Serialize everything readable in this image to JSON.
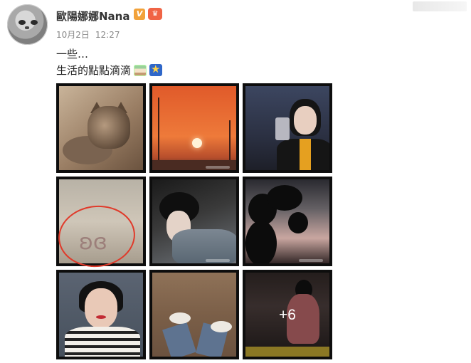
{
  "post": {
    "username": "歐陽娜娜Nana",
    "vip_badge": "V",
    "fan_badge_icon": "fan-badge-icon",
    "date": "10月2日",
    "time": "12:27",
    "line1": "一些…",
    "line2_text": "生活的點點滴滴",
    "line2_emojis": [
      "cake-emoji",
      "shooting-star-emoji"
    ]
  },
  "gallery": {
    "images": [
      {
        "name": "cat-photo"
      },
      {
        "name": "sunset-photo"
      },
      {
        "name": "mirror-selfie-photo"
      },
      {
        "name": "butterfly-photo"
      },
      {
        "name": "jacket-portrait-photo"
      },
      {
        "name": "tree-silhouette-photo"
      },
      {
        "name": "wink-portrait-photo"
      },
      {
        "name": "feet-photo"
      },
      {
        "name": "gym-photo"
      }
    ],
    "more_count": "+6"
  },
  "colors": {
    "highlight_circle": "#e03a2a",
    "vip_badge": "#f2a23a",
    "fan_badge": "#f06445"
  }
}
